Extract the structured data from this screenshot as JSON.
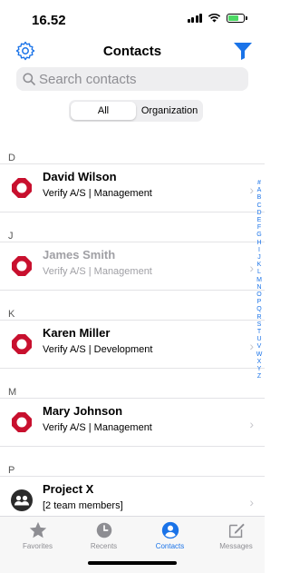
{
  "status": {
    "time": "16.52"
  },
  "nav": {
    "title": "Contacts"
  },
  "search": {
    "placeholder": "Search contacts"
  },
  "segments": {
    "all": "All",
    "organization": "Organization"
  },
  "sections": [
    {
      "letter": "D",
      "contact": {
        "name": "David Wilson",
        "company": "Verify A/S | Management"
      }
    },
    {
      "letter": "J",
      "contact": {
        "name": "James Smith",
        "company": "Verify A/S | Management"
      }
    },
    {
      "letter": "K",
      "contact": {
        "name": "Karen Miller",
        "company": "Verify A/S | Development"
      }
    },
    {
      "letter": "M",
      "contact": {
        "name": "Mary Johnson",
        "company": "Verify A/S | Management"
      }
    },
    {
      "letter": "P",
      "contact": {
        "name": "Project X",
        "company": "[2 team members]"
      }
    }
  ],
  "index_letters": [
    "#",
    "A",
    "B",
    "C",
    "D",
    "E",
    "F",
    "G",
    "H",
    "I",
    "J",
    "K",
    "L",
    "M",
    "N",
    "O",
    "P",
    "Q",
    "R",
    "S",
    "T",
    "U",
    "V",
    "W",
    "X",
    "Y",
    "Z"
  ],
  "tabs": [
    {
      "label": "Favorites",
      "icon": "star-icon"
    },
    {
      "label": "Recents",
      "icon": "clock-icon"
    },
    {
      "label": "Contacts",
      "icon": "person-icon"
    },
    {
      "label": "Messages",
      "icon": "compose-icon"
    }
  ],
  "colors": {
    "accent": "#1a73e8",
    "logo_red": "#c8102e",
    "battery": "#4cd964"
  }
}
